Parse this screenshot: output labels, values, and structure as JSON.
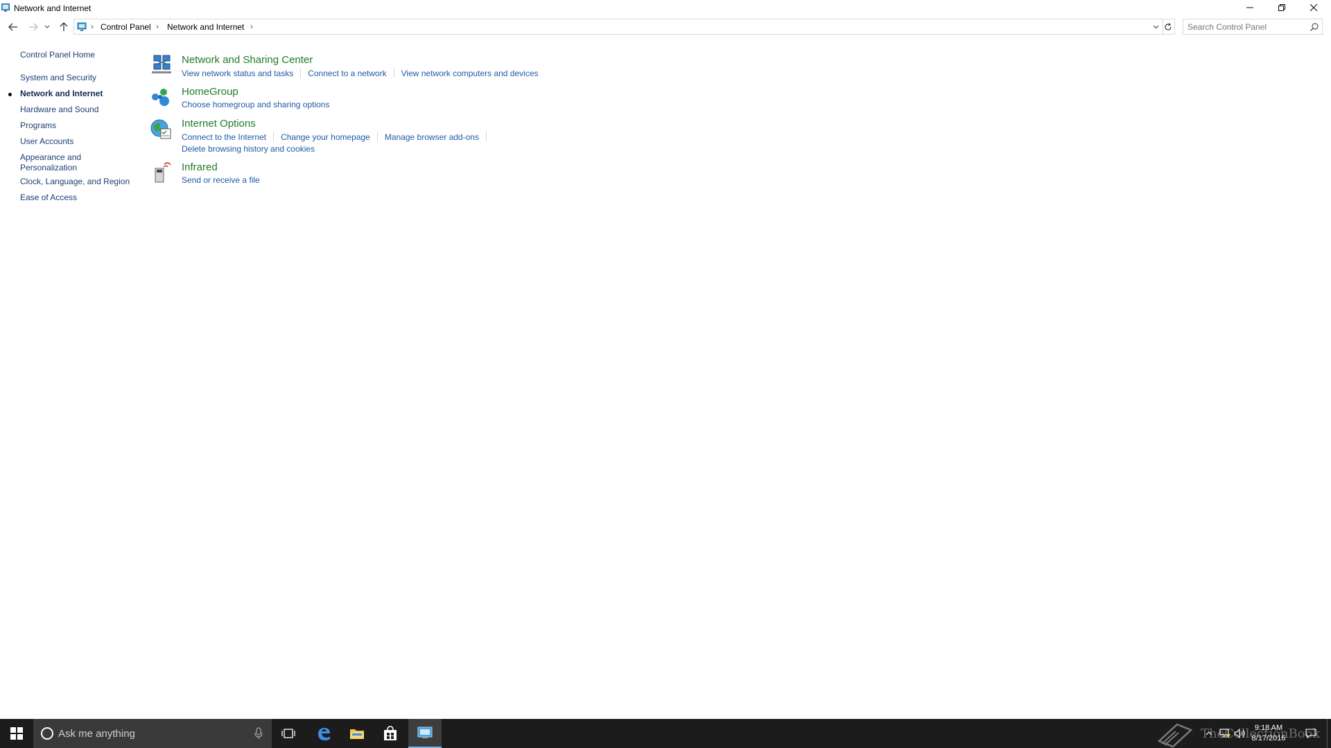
{
  "window": {
    "title": "Network and Internet",
    "buttons": {
      "minimize": "minimize-icon",
      "maximize": "restore-icon",
      "close": "close-icon"
    }
  },
  "address_bar": {
    "breadcrumbs": [
      "Control Panel",
      "Network and Internet"
    ],
    "search_placeholder": "Search Control Panel"
  },
  "left_nav": {
    "home": "Control Panel Home",
    "items": [
      {
        "label": "System and Security",
        "current": false
      },
      {
        "label": "Network and Internet",
        "current": true
      },
      {
        "label": "Hardware and Sound",
        "current": false
      },
      {
        "label": "Programs",
        "current": false
      },
      {
        "label": "User Accounts",
        "current": false
      },
      {
        "label": "Appearance and Personalization",
        "current": false
      },
      {
        "label": "Clock, Language, and Region",
        "current": false
      },
      {
        "label": "Ease of Access",
        "current": false
      }
    ]
  },
  "categories": [
    {
      "title": "Network and Sharing Center",
      "icon": "network-sharing-icon",
      "links": [
        "View network status and tasks",
        "Connect to a network",
        "View network computers and devices"
      ]
    },
    {
      "title": "HomeGroup",
      "icon": "homegroup-icon",
      "links": [
        "Choose homegroup and sharing options"
      ]
    },
    {
      "title": "Internet Options",
      "icon": "internet-options-icon",
      "links": [
        "Connect to the Internet",
        "Change your homepage",
        "Manage browser add-ons"
      ],
      "links_row2": [
        "Delete browsing history and cookies"
      ]
    },
    {
      "title": "Infrared",
      "icon": "infrared-icon",
      "links": [
        "Send or receive a file"
      ]
    }
  ],
  "taskbar": {
    "search_text": "Ask me anything",
    "time": "9:18 AM",
    "date": "8/17/2016",
    "watermark": "TheCollectionBook",
    "accent": "#76b9ed"
  },
  "colors": {
    "link_blue": "#1f5aa6",
    "category_green": "#1e7b25",
    "nav_blue": "#1a3e72",
    "taskbar": "#1c1c1c"
  }
}
